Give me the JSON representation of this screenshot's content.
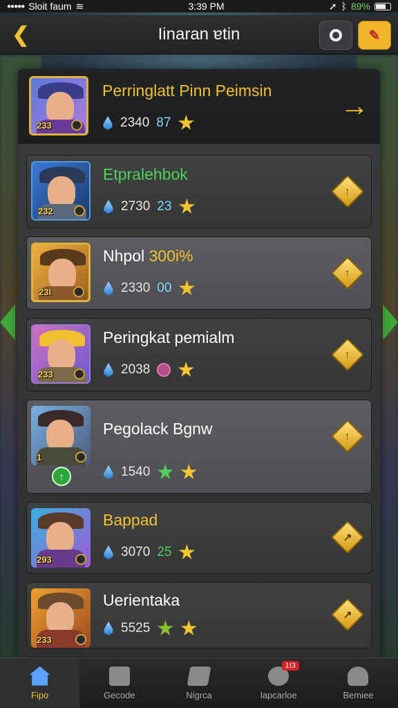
{
  "status_bar": {
    "carrier": "Sloit faum",
    "time": "3:39 PM",
    "battery": "89%"
  },
  "header": {
    "title": "Iinaran ɐtin"
  },
  "rows": [
    {
      "name": "Perringlatt Pinn Peimsin",
      "name_color": "#f2c12e",
      "level": "233",
      "points": "2340",
      "secondary": "87",
      "secondary_color": "#7fd7ff"
    },
    {
      "name": "Etpralehbok",
      "name_color": "#4fd25a",
      "level": "232",
      "points": "2730",
      "secondary": "23",
      "secondary_color": "#7fd7ff"
    },
    {
      "name": "Nhpol 300i%",
      "name_color": "#ffffff",
      "name_highlight": "300i%",
      "level": "23I",
      "points": "2330",
      "secondary": "00",
      "secondary_color": "#7fd7ff"
    },
    {
      "name": "Peringkat pemialm",
      "name_color": "#ffffff",
      "level": "233",
      "points": "2038",
      "secondary": "",
      "secondary_color": ""
    },
    {
      "name": "Pegolack Bgnw",
      "name_color": "#ffffff",
      "level": "1",
      "points": "1540",
      "secondary": "",
      "secondary_color": ""
    },
    {
      "name": "Bappad",
      "name_color": "#f2c12e",
      "level": "293",
      "points": "3070",
      "secondary": "25",
      "secondary_color": "#4fd25a"
    },
    {
      "name": "Uerientaka",
      "name_color": "#ffffff",
      "level": "233",
      "points": "5525",
      "secondary": "",
      "secondary_color": ""
    }
  ],
  "nav": [
    {
      "label": "Fipo",
      "active": true
    },
    {
      "label": "Gecode",
      "active": false
    },
    {
      "label": "Nigrca",
      "active": false
    },
    {
      "label": "lapcarloe",
      "active": false,
      "badge": "1I3"
    },
    {
      "label": "Bemiee",
      "active": false
    }
  ],
  "icons": [
    "back-arrow-icon",
    "settings-icon",
    "badge-icon",
    "drop-icon",
    "star-icon",
    "rank-up-icon",
    "home-icon"
  ]
}
